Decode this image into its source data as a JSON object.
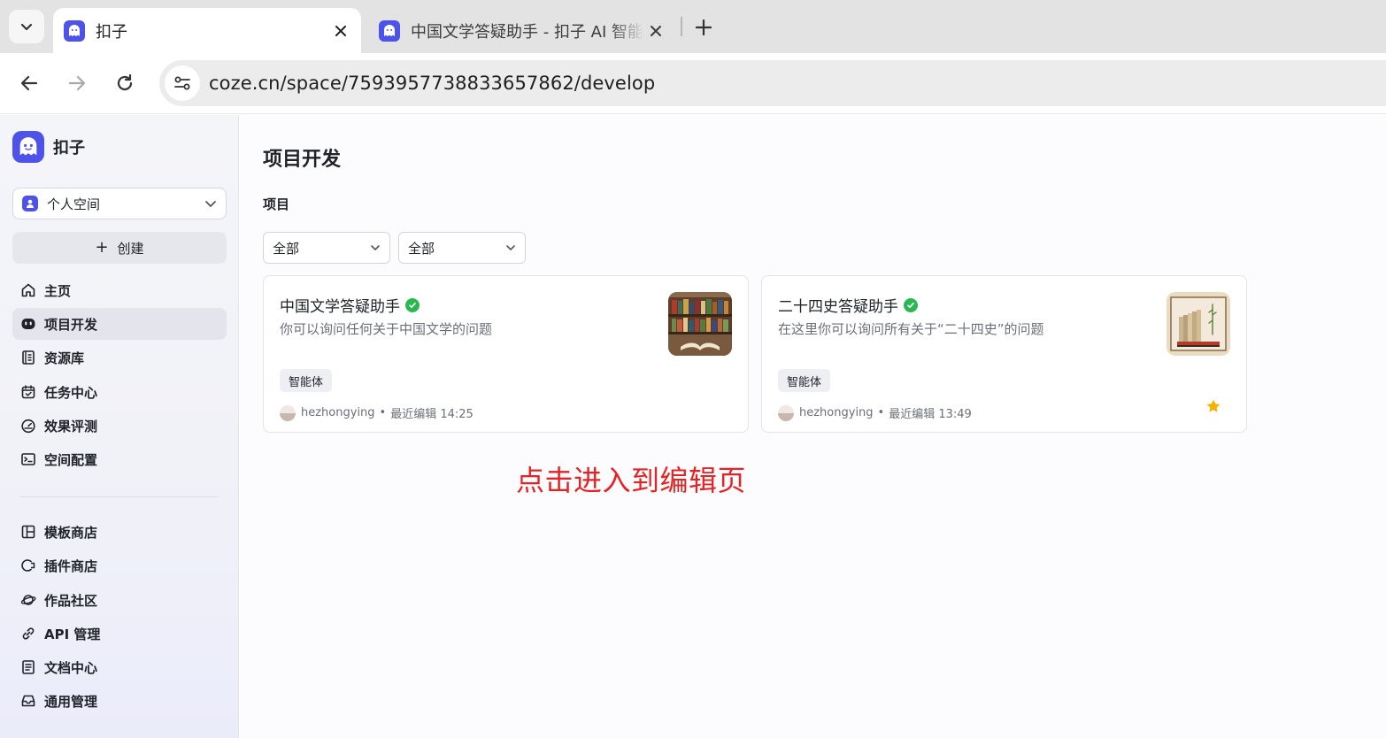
{
  "browser": {
    "tabs": [
      {
        "title": "扣子",
        "active": true
      },
      {
        "title": "中国文学答疑助手 - 扣子 AI 智能",
        "active": false
      }
    ],
    "url": "coze.cn/space/7593957738833657862/develop"
  },
  "sidebar": {
    "brand": "扣子",
    "space_label": "个人空间",
    "create_label": "创建",
    "items": [
      {
        "label": "主页",
        "icon": "home-icon",
        "selected": false
      },
      {
        "label": "项目开发",
        "icon": "bot-icon",
        "selected": true
      },
      {
        "label": "资源库",
        "icon": "library-icon",
        "selected": false
      },
      {
        "label": "任务中心",
        "icon": "task-icon",
        "selected": false
      },
      {
        "label": "效果评测",
        "icon": "gauge-icon",
        "selected": false
      },
      {
        "label": "空间配置",
        "icon": "terminal-icon",
        "selected": false
      }
    ],
    "bottom_items": [
      {
        "label": "模板商店",
        "icon": "template-icon"
      },
      {
        "label": "插件商店",
        "icon": "plugin-icon"
      },
      {
        "label": "作品社区",
        "icon": "planet-icon"
      },
      {
        "label": "API 管理",
        "icon": "link-icon"
      },
      {
        "label": "文档中心",
        "icon": "document-icon"
      },
      {
        "label": "通用管理",
        "icon": "inbox-icon"
      }
    ]
  },
  "main": {
    "title": "项目开发",
    "section": "项目",
    "filters": [
      "全部",
      "全部"
    ],
    "cards": [
      {
        "title": "中国文学答疑助手",
        "description": "你可以询问任何关于中国文学的问题",
        "tag": "智能体",
        "author": "hezhongying",
        "edited": "最近编辑 14:25",
        "starred": false
      },
      {
        "title": "二十四史答疑助手",
        "description": "在这里你可以询问所有关于“二十四史”的问题",
        "tag": "智能体",
        "author": "hezhongying",
        "edited": "最近编辑 13:49",
        "starred": true
      }
    ]
  },
  "annotation": "点击进入到编辑页",
  "colors": {
    "brand": "#4d53e8",
    "verified": "#2db752",
    "annotation": "#e32424",
    "star": "#f5b301"
  }
}
